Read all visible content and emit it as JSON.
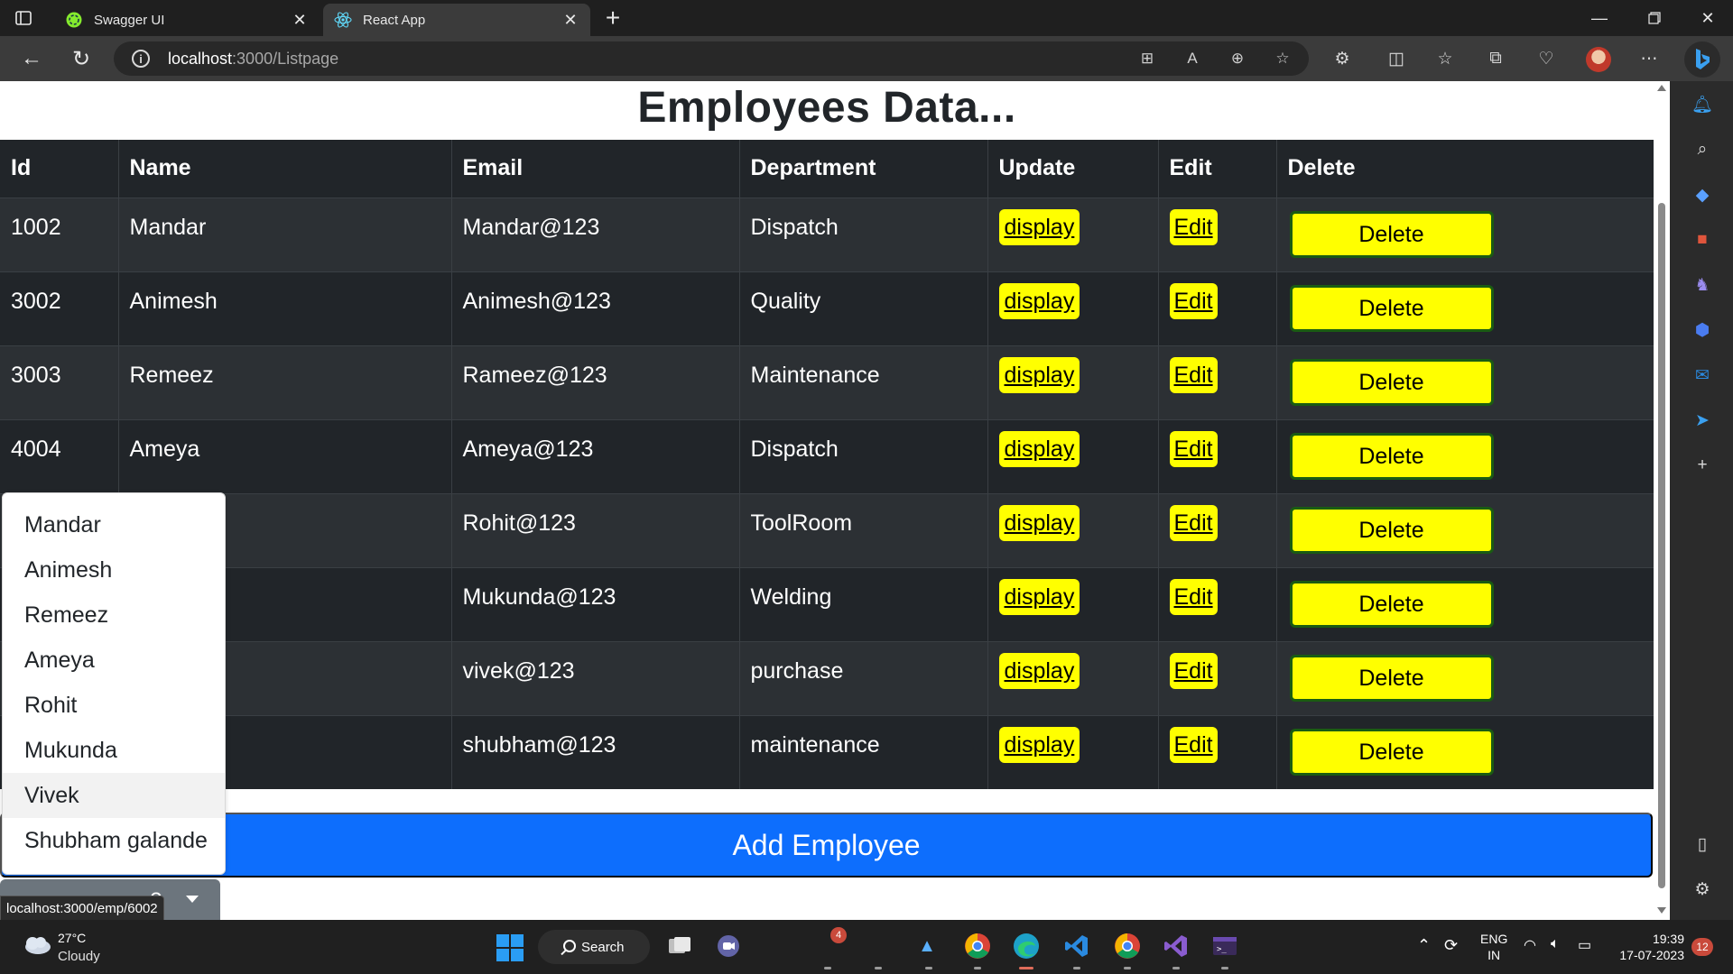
{
  "browser": {
    "tabs": [
      {
        "title": "Swagger UI",
        "active": false,
        "icon": "swagger-icon"
      },
      {
        "title": "React App",
        "active": true,
        "icon": "react-icon"
      }
    ],
    "url_host": "localhost",
    "url_path": ":3000/Listpage",
    "status_url": "localhost:3000/emp/6002"
  },
  "page": {
    "title": "Employees Data...",
    "columns": [
      "Id",
      "Name",
      "Email",
      "Department",
      "Update",
      "Edit",
      "Delete"
    ],
    "rows": [
      {
        "id": "1002",
        "name": "Mandar",
        "email": "Mandar@123",
        "department": "Dispatch"
      },
      {
        "id": "3002",
        "name": "Animesh",
        "email": "Animesh@123",
        "department": "Quality"
      },
      {
        "id": "3003",
        "name": "Remeez",
        "email": "Rameez@123",
        "department": "Maintenance"
      },
      {
        "id": "4004",
        "name": "Ameya",
        "email": "Ameya@123",
        "department": "Dispatch"
      },
      {
        "id": "",
        "name": "",
        "email": "Rohit@123",
        "department": "ToolRoom"
      },
      {
        "id": "",
        "name": "",
        "email": "Mukunda@123",
        "department": "Welding"
      },
      {
        "id": "",
        "name": "",
        "email": "vivek@123",
        "department": "purchase"
      },
      {
        "id": "",
        "name": "galande",
        "email": "shubham@123",
        "department": "maintenance"
      }
    ],
    "update_label": "display",
    "edit_label": "Edit",
    "delete_label": "Delete",
    "add_button": "Add Employee",
    "dropdown": {
      "toggle_label_fragment": "e",
      "items": [
        "Mandar",
        "Animesh",
        "Remeez",
        "Ameya",
        "Rohit",
        "Mukunda",
        "Vivek",
        "Shubham galande"
      ],
      "hovered": "Vivek"
    }
  },
  "taskbar": {
    "weather_temp": "27°C",
    "weather_desc": "Cloudy",
    "search_label": "Search",
    "teams_badge": "4",
    "lang_line1": "ENG",
    "lang_line2": "IN",
    "time": "19:39",
    "date": "17-07-2023",
    "notifications": "12"
  },
  "colors": {
    "accent_button": "#0d6efd",
    "action_yellow": "#ffff00",
    "table_dark": "#212529"
  }
}
